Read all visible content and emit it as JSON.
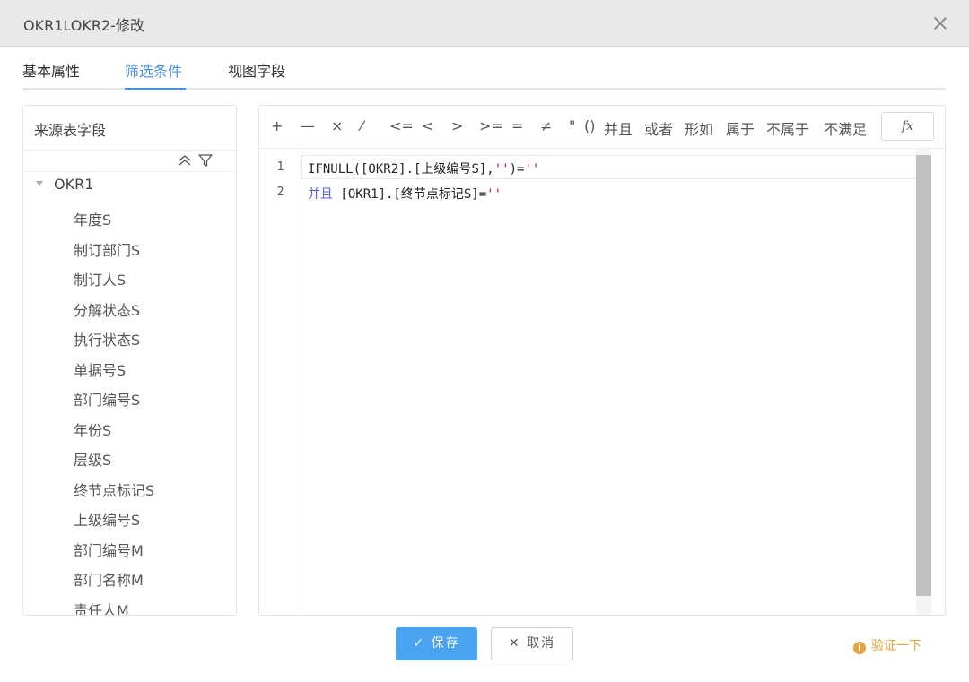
{
  "dialog": {
    "title": "OKR1LOKR2-修改"
  },
  "tabs": [
    {
      "label": "基本属性"
    },
    {
      "label": "筛选条件"
    },
    {
      "label": "视图字段"
    }
  ],
  "left_panel": {
    "title": "来源表字段",
    "tree": {
      "root": "OKR1",
      "items": [
        "年度S",
        "制订部门S",
        "制订人S",
        "分解状态S",
        "执行状态S",
        "单据号S",
        "部门编号S",
        "年份S",
        "层级S",
        "终节点标记S",
        "上级编号S",
        "部门编号M",
        "部门名称M",
        "责任人M"
      ]
    }
  },
  "toolbar": {
    "operators": [
      "+",
      "—",
      "×",
      "⁄",
      "<=",
      "<",
      ">",
      ">=",
      "=",
      "≠",
      "\"",
      "()",
      "并且",
      "或者",
      "形如",
      "属于",
      "不属于",
      "不满足"
    ],
    "fx_label": "fx"
  },
  "editor": {
    "line_numbers": [
      "1",
      "2"
    ],
    "line1": {
      "p1": "IFNULL([OKR2].[",
      "p2": "上级编号",
      "p3": "S],",
      "p4": "''",
      "p5": ")=",
      "p6": "''"
    },
    "line2": {
      "kw": "并且",
      "p1": " [OKR1].[",
      "p2": "终节点标记",
      "p3": "S]=",
      "p4": "''"
    }
  },
  "footer": {
    "save_label": "保存",
    "cancel_label": "取消",
    "verify_label": "验证一下"
  },
  "colors": {
    "accent": "#4a90e2",
    "save_button": "#4aa3f0",
    "warning": "#e6a23c"
  }
}
